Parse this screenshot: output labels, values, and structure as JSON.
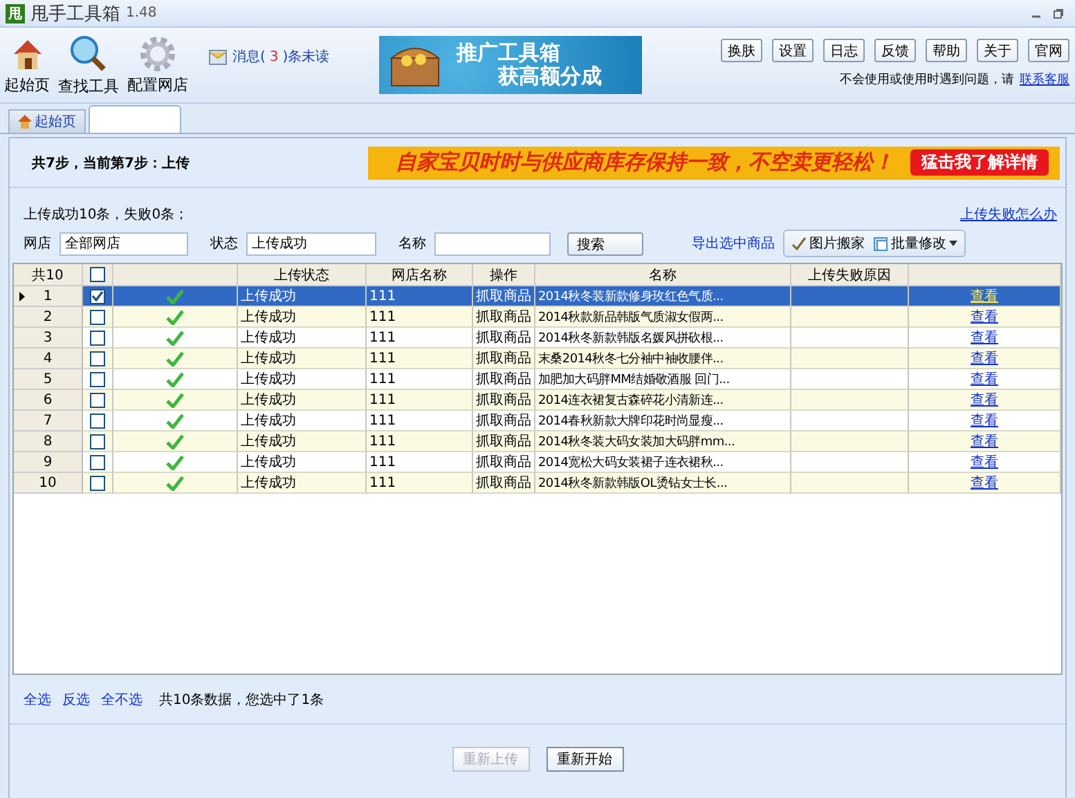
{
  "window": {
    "logo": "甩",
    "title": "甩手工具箱",
    "version": "1.48"
  },
  "toolbar": {
    "tools": [
      {
        "label": "起始页"
      },
      {
        "label": "查找工具"
      },
      {
        "label": "配置网店"
      }
    ],
    "message": {
      "prefix": "消息(",
      "count": "3",
      "suffix": ")条未读"
    },
    "promo": {
      "line1": "推广工具箱",
      "line2": "获高额分成"
    },
    "buttons": [
      "换肤",
      "设置",
      "日志",
      "反馈",
      "帮助",
      "关于",
      "官网"
    ],
    "help_text": "不会使用或使用时遇到问题，请",
    "help_link": "联系客服"
  },
  "tabs": [
    {
      "label": "起始页",
      "selected": false
    }
  ],
  "step": {
    "text": "共7步，当前第7步：上传",
    "ad_text": "自家宝贝时时与供应商库存保持一致，不空卖更轻松！",
    "ad_button": "猛击我了解详情"
  },
  "filters": {
    "summary": "上传成功10条，失败0条；",
    "help_link": "上传失败怎么办",
    "fields": [
      {
        "label": "网店",
        "value": "全部网店"
      },
      {
        "label": "状态",
        "value": "上传成功"
      },
      {
        "label": "名称"
      }
    ],
    "search_button": "搜索",
    "export_link": "导出选中商品",
    "tools": [
      {
        "label": "图片搬家",
        "dropdown": false
      },
      {
        "label": "批量修改",
        "dropdown": true
      }
    ]
  },
  "table": {
    "count": "共10",
    "all_checked": false,
    "columns": [
      "上传状态",
      "网店名称",
      "操作",
      "名称",
      "上传失败原因"
    ],
    "rows": [
      {
        "no": "1",
        "checked": true,
        "selected": true,
        "status": "上传成功",
        "shop": "111",
        "op": "抓取商品",
        "name": "2014秋冬装新款修身玫红色气质...",
        "link": "查看"
      },
      {
        "no": "2",
        "checked": false,
        "selected": false,
        "status": "上传成功",
        "shop": "111",
        "op": "抓取商品",
        "name": "2014秋款新品韩版气质淑女假两...",
        "link": "查看"
      },
      {
        "no": "3",
        "checked": false,
        "selected": false,
        "status": "上传成功",
        "shop": "111",
        "op": "抓取商品",
        "name": "2014秋冬新款韩版名媛风拼砍根...",
        "link": "查看"
      },
      {
        "no": "4",
        "checked": false,
        "selected": false,
        "status": "上传成功",
        "shop": "111",
        "op": "抓取商品",
        "name": "末桑2014秋冬七分袖中袖收腰伴...",
        "link": "查看"
      },
      {
        "no": "5",
        "checked": false,
        "selected": false,
        "status": "上传成功",
        "shop": "111",
        "op": "抓取商品",
        "name": "加肥加大码胖MM结婚敬酒服 回门...",
        "link": "查看"
      },
      {
        "no": "6",
        "checked": false,
        "selected": false,
        "status": "上传成功",
        "shop": "111",
        "op": "抓取商品",
        "name": "2014连衣裙复古森碎花小清新连...",
        "link": "查看"
      },
      {
        "no": "7",
        "checked": false,
        "selected": false,
        "status": "上传成功",
        "shop": "111",
        "op": "抓取商品",
        "name": "2014春秋新款大牌印花时尚显瘦...",
        "link": "查看"
      },
      {
        "no": "8",
        "checked": false,
        "selected": false,
        "status": "上传成功",
        "shop": "111",
        "op": "抓取商品",
        "name": "2014秋冬装大码女装加大码胖mm...",
        "link": "查看"
      },
      {
        "no": "9",
        "checked": false,
        "selected": false,
        "status": "上传成功",
        "shop": "111",
        "op": "抓取商品",
        "name": "2014宽松大码女装裙子连衣裙秋...",
        "link": "查看"
      },
      {
        "no": "10",
        "checked": false,
        "selected": false,
        "status": "上传成功",
        "shop": "111",
        "op": "抓取商品",
        "name": "2014秋冬新款韩版OL烫钻女士长...",
        "link": "查看"
      }
    ]
  },
  "footer": {
    "links": [
      "全选",
      "反选",
      "全不选"
    ],
    "summary": "共10条数据，您选中了1条"
  },
  "actions": [
    {
      "label": "重新上传",
      "disabled": true
    },
    {
      "label": "重新开始",
      "disabled": false
    }
  ]
}
